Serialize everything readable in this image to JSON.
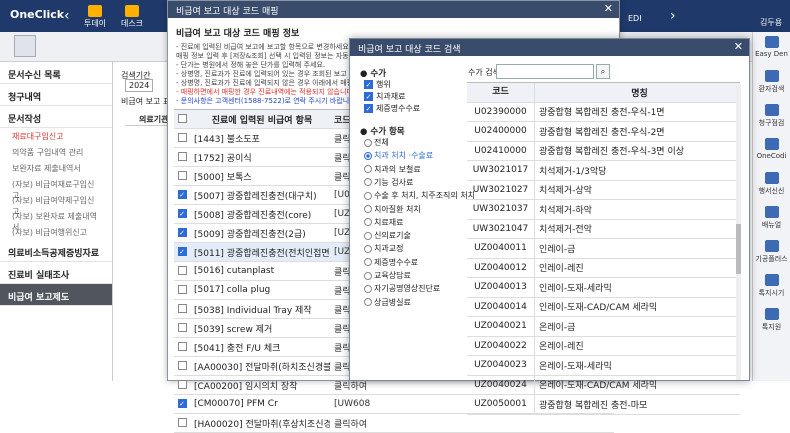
{
  "app": {
    "logo": "OneClick",
    "tb1": "투데이",
    "tb2": "데스크",
    "btn_edi": "EDI",
    "user": "김두용"
  },
  "left_nav": {
    "items": [
      {
        "label": "문서수신 목록",
        "type": "h"
      },
      {
        "label": "청구내역",
        "type": "h"
      },
      {
        "label": "문서작성",
        "type": "h"
      },
      {
        "label": "재료대구입신고",
        "type": "s",
        "red": true
      },
      {
        "label": "의약품 구입내역 관리",
        "type": "s"
      },
      {
        "label": "보완자료 제출내역서",
        "type": "s"
      },
      {
        "label": "(자보) 비급여재료구입신고",
        "type": "s"
      },
      {
        "label": "(자보) 비급여약제구입신고",
        "type": "s"
      },
      {
        "label": "(자보) 보완자료 제출내역서",
        "type": "s"
      },
      {
        "label": "(자보) 비급여행위신고",
        "type": "s"
      },
      {
        "label": "의료비소득공제증빙자료",
        "type": "h"
      },
      {
        "label": "진료비 실태조사",
        "type": "h"
      },
      {
        "label": "비급여 보고제도",
        "type": "h",
        "active": true
      }
    ]
  },
  "mid": {
    "search_label": "검색기간",
    "search_value": "2024",
    "tab_label": "비급여 보고 표",
    "col_label": "의료기관"
  },
  "right_bar": {
    "items": [
      "Easy Den",
      "환자검색",
      "청구점검",
      "OneCodi",
      "행서신신",
      "배뉴얼",
      "기공플러스",
      "톡지시기",
      "톡지원"
    ]
  },
  "dialog1": {
    "title": "비급여 보고 대상 코드 매핑",
    "section": "비급여 보고 대상 코드 매핑 정보",
    "lines": [
      {
        "text": "- 진료에 입력된 비급여 보고에 보고할 항목으로 변경하세요. 보",
        "c": ""
      },
      {
        "text": "  매핑 정보 입력 후 [저장&조회] 선택 시 입력된 정보는 자동 유지",
        "c": ""
      },
      {
        "text": "- 단가는 병원에서 정해 놓은 단가를 입력해 주세요.",
        "c": ""
      },
      {
        "text": "- 상병명, 진료과가 진료에 입력되어 있는 경우 조회된 보고 대상",
        "c": ""
      },
      {
        "text": "- 상병명, 진료과가 진료에 입력되지 않은 경우 아래에서 매핑한",
        "c": ""
      },
      {
        "text": "- 매핑하면에서 매핑한 경우 진료내역에는 적용되지 않습니다. 조",
        "c": "red"
      },
      {
        "text": "- 문의사항은 고객센터(1588-7522)로 연락 주시기 바랍니다.",
        "c": "blue"
      }
    ],
    "grid_head": {
      "col1": "진료에 입력된 비급여 항목",
      "col2": "코드"
    },
    "rows": [
      {
        "name": "[1443] 불소도포",
        "code": "클릭하여",
        "checked": false,
        "sel": false
      },
      {
        "name": "[1752] 공이식",
        "code": "클릭하여",
        "checked": false,
        "sel": false
      },
      {
        "name": "[5000] 보톡스",
        "code": "클릭하여",
        "checked": false,
        "sel": false
      },
      {
        "name": "[5007] 광중합레진충전(대구치)",
        "code": "[U02390",
        "checked": true,
        "sel": false
      },
      {
        "name": "[5008] 광중합레진충전(core)",
        "code": "[UZ005",
        "checked": true,
        "sel": false
      },
      {
        "name": "[5009] 광중합레진충전(2급)",
        "code": "[UZ005",
        "checked": true,
        "sel": false
      },
      {
        "name": "[5011] 광중합레진충전(전치인접면)",
        "code": "[UZ005",
        "checked": true,
        "sel": true
      },
      {
        "name": "[5016] cutanplast",
        "code": "클릭하여",
        "checked": false,
        "sel": false
      },
      {
        "name": "[5017] colla plug",
        "code": "클릭하여",
        "checked": false,
        "sel": false
      },
      {
        "name": "[5038] Individual Tray 제작",
        "code": "클릭하여",
        "checked": false,
        "sel": false
      },
      {
        "name": "[5039] screw 제거",
        "code": "클릭하여",
        "checked": false,
        "sel": false
      },
      {
        "name": "[5041] 충전 F/U 체크",
        "code": "클릭하여",
        "checked": false,
        "sel": false
      },
      {
        "name": "[AA00030] 전달마취(하치조신경블록)",
        "code": "클릭하여",
        "checked": false,
        "sel": false
      },
      {
        "name": "[CA00200] 임시의치 장착",
        "code": "클릭하여",
        "checked": false,
        "sel": false
      },
      {
        "name": "[CM00070] PFM Cr",
        "code": "[UW608",
        "checked": true,
        "sel": false
      },
      {
        "name": "[HA00020] 전달마취(후상치조신경블록)",
        "code": "클릭하여",
        "checked": false,
        "sel": false
      }
    ]
  },
  "dialog2": {
    "title": "비급여 보고 대상 코드 검색",
    "sec_kind": "수가",
    "kinds": [
      {
        "label": "행위",
        "on": true
      },
      {
        "label": "치과재료",
        "on": true
      },
      {
        "label": "제증명수수료",
        "on": true
      }
    ],
    "sec_items": "수가 항목",
    "items": [
      {
        "label": "전체",
        "on": false
      },
      {
        "label": "치과 처치 ·수술료",
        "on": true
      },
      {
        "label": "치과의 보철료",
        "on": false
      },
      {
        "label": "기능 검사료",
        "on": false
      },
      {
        "label": "수술 후 처치, 치주조직의 처치",
        "on": false
      },
      {
        "label": "치아질환 처치",
        "on": false
      },
      {
        "label": "치료재료",
        "on": false
      },
      {
        "label": "신의료기술",
        "on": false
      },
      {
        "label": "치과교정",
        "on": false
      },
      {
        "label": "제증명수수료",
        "on": false
      },
      {
        "label": "교육상담료",
        "on": false
      },
      {
        "label": "자기공명영상진단료",
        "on": false
      },
      {
        "label": "상급병실료",
        "on": false
      }
    ],
    "search_label": "수가 검색",
    "search_value": "",
    "table_head": {
      "code": "코드",
      "name": "명칭"
    },
    "rows": [
      {
        "code": "U02390000",
        "name": "광중합형 복합레진 충전-우식-1면"
      },
      {
        "code": "U02400000",
        "name": "광중합형 복합레진 충전-우식-2면"
      },
      {
        "code": "U02410000",
        "name": "광중합형 복합레진 충전-우식-3면 이상"
      },
      {
        "code": "UW3021017",
        "name": "치석제거-1/3악당"
      },
      {
        "code": "UW3021027",
        "name": "치석제거-상악"
      },
      {
        "code": "UW3021037",
        "name": "치석제거-하악"
      },
      {
        "code": "UW3021047",
        "name": "치석제거-전악"
      },
      {
        "code": "UZ0040011",
        "name": "인레이-금"
      },
      {
        "code": "UZ0040012",
        "name": "인레이-레진"
      },
      {
        "code": "UZ0040013",
        "name": "인레이-도재-세라믹"
      },
      {
        "code": "UZ0040014",
        "name": "인레이-도재-CAD/CAM 세라믹"
      },
      {
        "code": "UZ0040021",
        "name": "온레이-금"
      },
      {
        "code": "UZ0040022",
        "name": "온레이-레진"
      },
      {
        "code": "UZ0040023",
        "name": "온레이-도재-세라믹"
      },
      {
        "code": "UZ0040024",
        "name": "온레이-도재-CAD/CAM 세라믹"
      },
      {
        "code": "UZ0050001",
        "name": "광중합형 복합레진 충전-마모"
      }
    ]
  }
}
